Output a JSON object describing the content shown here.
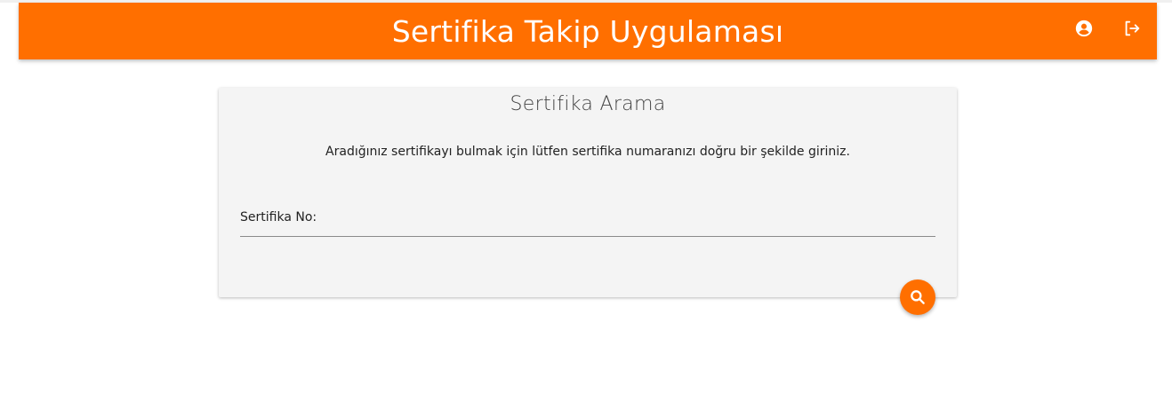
{
  "app": {
    "title": "Sertifika Takip Uygulaması",
    "accent_color": "#ff6f00",
    "icons": [
      "account-circle-icon",
      "logout-icon"
    ]
  },
  "card": {
    "title": "Sertifika Arama",
    "description": "Aradığınız sertifikayı bulmak için lütfen sertifika numaranızı doğru bir şekilde giriniz.",
    "field_label": "Sertifika No:",
    "field_value": "",
    "search_icon": "search-icon"
  }
}
